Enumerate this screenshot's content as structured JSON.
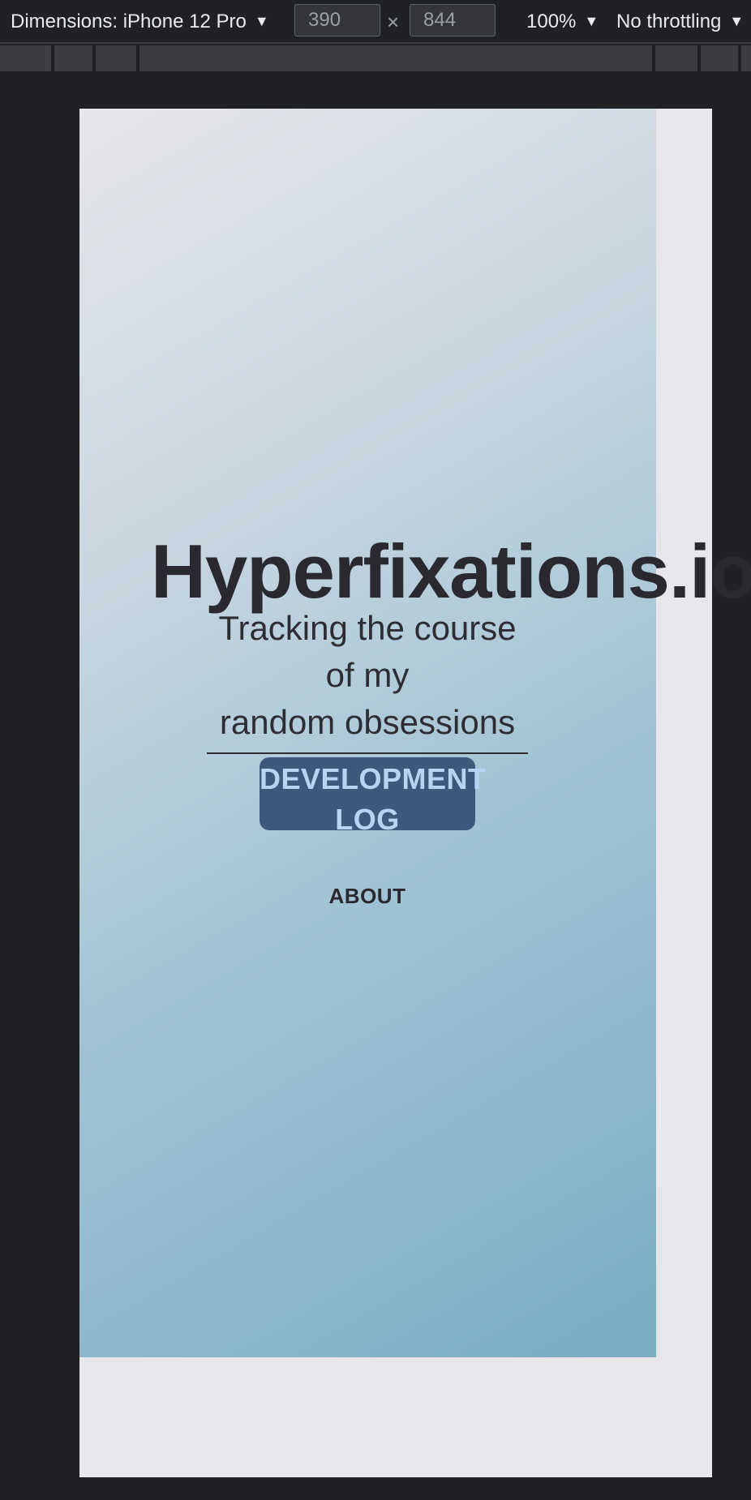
{
  "devtools": {
    "dimensions_label": "Dimensions: iPhone 12 Pro",
    "width_value": "390",
    "times": "×",
    "height_value": "844",
    "zoom_label": "100%",
    "throttle_label": "No throttling",
    "caret": "▼"
  },
  "page": {
    "title": "Hyperfixations.io",
    "tagline_line1": "Tracking the course of my",
    "tagline_line2": "random obsessions",
    "dev_log_line1": "DEVELOPMENT",
    "dev_log_line2": "LOG",
    "about": "ABOUT"
  },
  "colors": {
    "gradient_start": "#e7e6ea",
    "gradient_end": "#78adc3",
    "button_bg": "#3f597e",
    "button_text": "#b8d4f5",
    "text_dark": "#2a2930",
    "chrome_bg": "#202124"
  }
}
